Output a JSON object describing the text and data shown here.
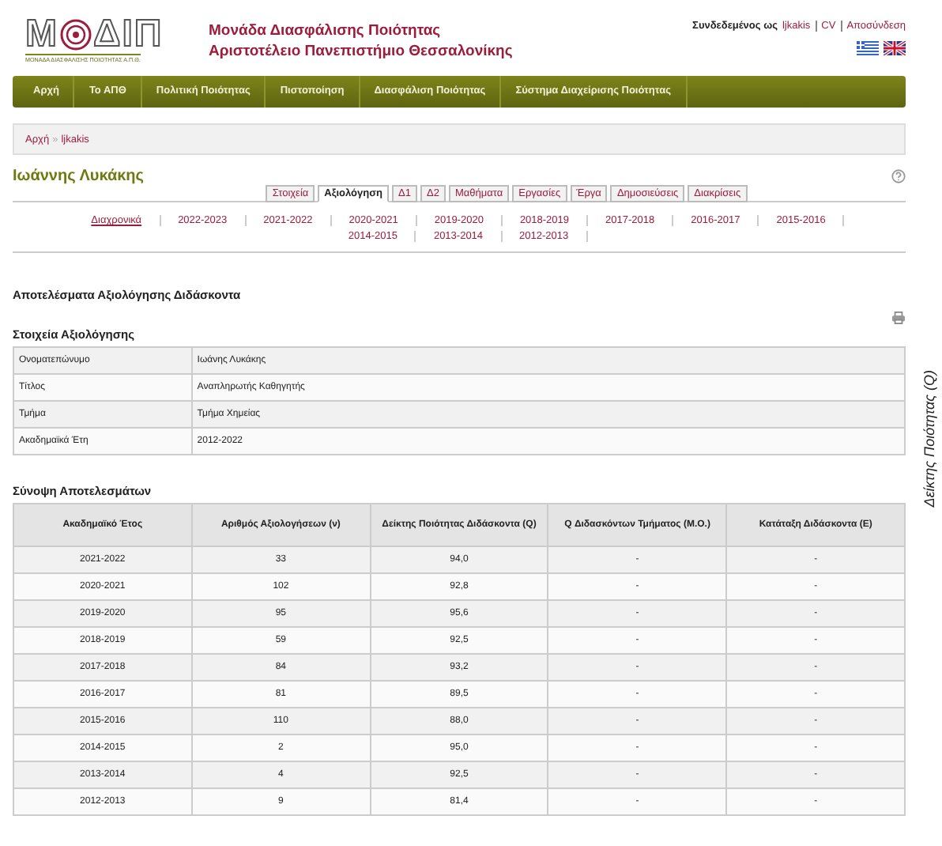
{
  "logo": {
    "letters_left": "Μ",
    "letters_right": "ΔΙΠ",
    "subtitle": "ΜΟΝΑΔΑ ΔΙΑΣΦΑΛΙΣΗΣ ΠΟΙΟΤΗΤΑΣ Α.Π.Θ."
  },
  "site_title": [
    "Μονάδα Διασφάλισης Ποιότητας",
    "Αριστοτέλειο Πανεπιστήμιο Θεσσαλονίκης"
  ],
  "user_bar": {
    "prefix": "Συνδεδεμένος ως",
    "user": "ljkakis",
    "links": [
      "CV",
      "Αποσύνδεση"
    ]
  },
  "nav": [
    "Αρχή",
    "Το ΑΠΘ",
    "Πολιτική Ποιότητας",
    "Πιστοποίηση",
    "Διασφάλιση Ποιότητας",
    "Σύστημα Διαχείρισης Ποιότητας"
  ],
  "breadcrumb": {
    "separator": "»",
    "items": [
      "Αρχή",
      "ljkakis"
    ]
  },
  "person": "Ιωάννης Λυκάκης",
  "tabs": [
    {
      "label": "Στοιχεία",
      "selected": false
    },
    {
      "label": "Αξιολόγηση",
      "selected": true
    },
    {
      "label": "Δ1",
      "selected": false
    },
    {
      "label": "Δ2",
      "selected": false
    },
    {
      "label": "Μαθήματα",
      "selected": false
    },
    {
      "label": "Εργασίες",
      "selected": false
    },
    {
      "label": "Έργα",
      "selected": false
    },
    {
      "label": "Δημοσιεύσεις",
      "selected": false
    },
    {
      "label": "Διακρίσεις",
      "selected": false
    }
  ],
  "periods": [
    {
      "label": "Διαχρονικά",
      "selected": true
    },
    {
      "label": "2022-2023",
      "selected": false
    },
    {
      "label": "2021-2022",
      "selected": false
    },
    {
      "label": "2020-2021",
      "selected": false
    },
    {
      "label": "2019-2020",
      "selected": false
    },
    {
      "label": "2018-2019",
      "selected": false
    },
    {
      "label": "2017-2018",
      "selected": false
    },
    {
      "label": "2016-2017",
      "selected": false
    },
    {
      "label": "2015-2016",
      "selected": false
    },
    {
      "label": "2014-2015",
      "selected": false
    },
    {
      "label": "2013-2014",
      "selected": false
    },
    {
      "label": "2012-2013",
      "selected": false
    }
  ],
  "page_title": "Αποτελέσματα Αξιολόγησης Διδάσκοντα",
  "info": {
    "title": "Στοιχεία Αξιολόγησης",
    "rows": [
      [
        "Ονοματεπώνυμο",
        "Ιωάνης Λυκάκης"
      ],
      [
        "Τίτλος",
        "Αναπληρωτής Καθηγητής"
      ],
      [
        "Τμήμα",
        "Τμήμα Χημείας"
      ],
      [
        "Ακαδημαϊκά Έτη",
        "2012-2022"
      ]
    ]
  },
  "summary": {
    "title": "Σύνοψη Αποτελεσμάτων",
    "columns": [
      "Ακαδημαϊκό Έτος",
      "Αριθμός Αξιολογήσεων (ν)",
      "Δείκτης Ποιότητας Διδάσκοντα (Q)",
      "Q Διδασκόντων Τμήματος (Μ.Ο.)",
      "Κατάταξη Διδάσκοντα (Ε)"
    ],
    "rows": [
      [
        "2021-2022",
        "33",
        "94,0",
        "-",
        "-"
      ],
      [
        "2020-2021",
        "102",
        "92,8",
        "-",
        "-"
      ],
      [
        "2019-2020",
        "95",
        "95,6",
        "-",
        "-"
      ],
      [
        "2018-2019",
        "59",
        "92,5",
        "-",
        "-"
      ],
      [
        "2017-2018",
        "84",
        "93,2",
        "-",
        "-"
      ],
      [
        "2016-2017",
        "81",
        "89,5",
        "-",
        "-"
      ],
      [
        "2015-2016",
        "110",
        "88,0",
        "-",
        "-"
      ],
      [
        "2014-2015",
        "2",
        "95,0",
        "-",
        "-"
      ],
      [
        "2013-2014",
        "4",
        "92,5",
        "-",
        "-"
      ],
      [
        "2012-2013",
        "9",
        "81,4",
        "-",
        "-"
      ]
    ]
  },
  "side_label": "Δείκτης Ποιότητας (Q)"
}
